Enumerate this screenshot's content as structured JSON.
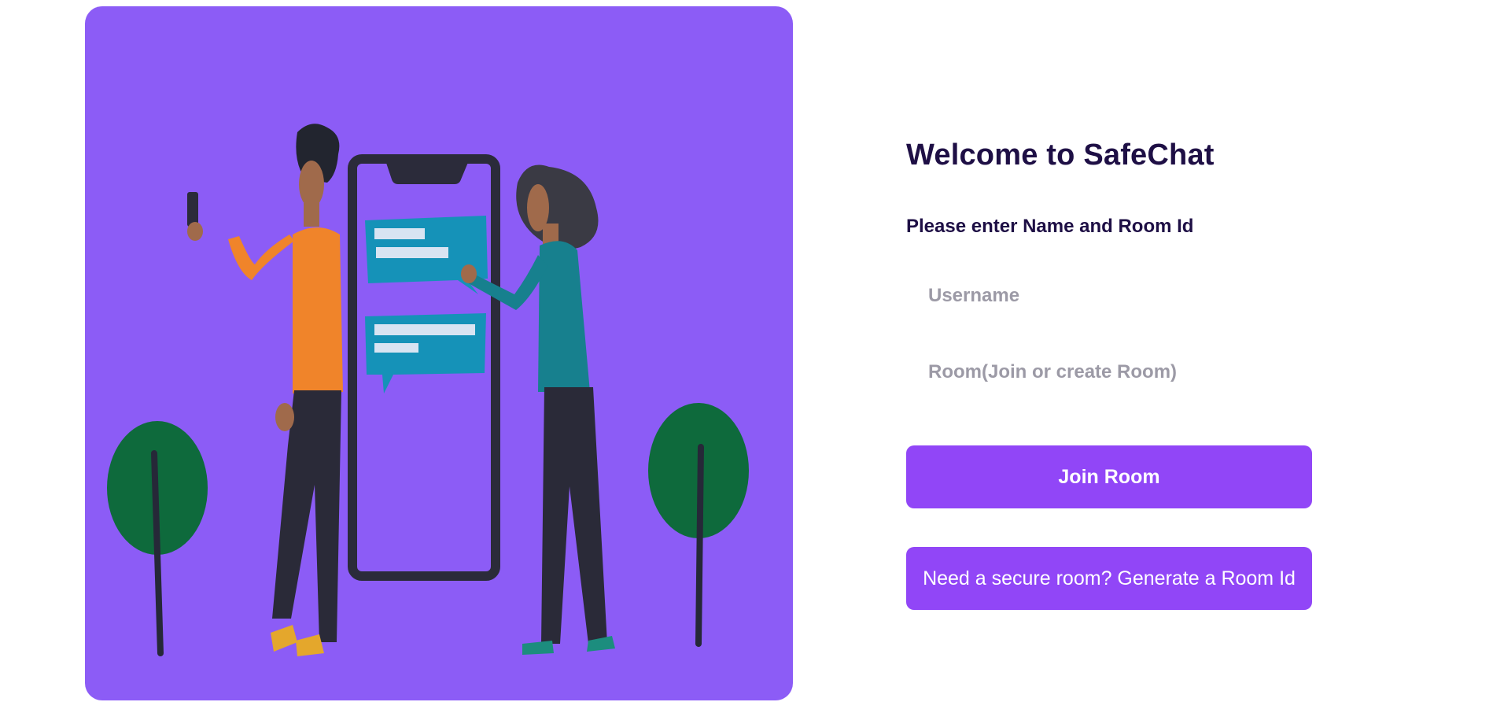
{
  "hero": {
    "illustration": "people-chatting-with-phone-illustration",
    "background_color": "#8c5cf6"
  },
  "login": {
    "title": "Welcome to SafeChat",
    "subtitle": "Please enter Name and Room Id",
    "username_placeholder": "Username",
    "username_value": "",
    "room_placeholder": "Room(Join or create Room)",
    "room_value": "",
    "join_label": "Join Room",
    "generate_label": "Need a secure room? Generate a Room Id"
  },
  "colors": {
    "title": "#1e0f45",
    "button": "#9146f7",
    "placeholder": "#9c9aa6"
  }
}
